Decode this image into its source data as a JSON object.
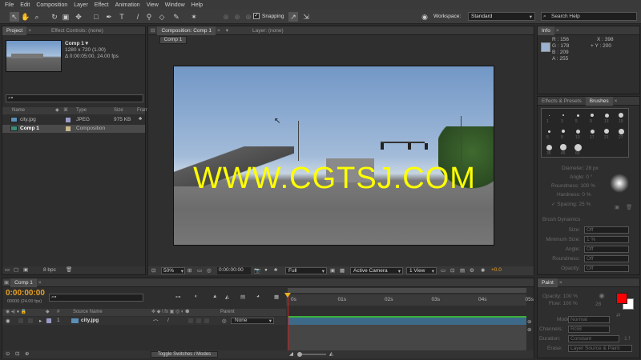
{
  "menu": [
    "File",
    "Edit",
    "Composition",
    "Layer",
    "Effect",
    "Animation",
    "View",
    "Window",
    "Help"
  ],
  "toolbar": {
    "snapping_label": "Snapping",
    "workspace_label": "Workspace:",
    "workspace_value": "Standard",
    "search_placeholder": "Search Help"
  },
  "project": {
    "tab": "Project",
    "effect_controls_tab": "Effect Controls: (none)",
    "selected_name": "Comp 1",
    "selected_dims": "1280 x 720 (1.00)",
    "selected_duration": "Δ 0:00:05:00, 24.00 fps",
    "columns": {
      "name": "Name",
      "type": "Type",
      "size": "Size",
      "frame": "Fram"
    },
    "items": [
      {
        "name": "city.jpg",
        "type": "JPEG",
        "size": "975 KB"
      },
      {
        "name": "Comp 1",
        "type": "Composition",
        "size": ""
      }
    ],
    "bpc": "8 bpc"
  },
  "composition": {
    "tab": "Composition: Comp 1",
    "layer_tab": "Layer: (none)",
    "comp_button": "Comp 1",
    "watermark": "WWW.CGTSJ.COM",
    "zoom": "50%",
    "timecode": "0:00:00:00",
    "resolution": "Full",
    "camera": "Active Camera",
    "view": "1 View",
    "exposure": "+0.0"
  },
  "info": {
    "tab": "Info",
    "r": "R : 156",
    "g": "G : 178",
    "b": "B : 209",
    "a": "A : 255",
    "x": "X : 398",
    "y": "+ Y : 200",
    "swatch": "#9cb2d1"
  },
  "brushes": {
    "tab_effects": "Effects & Presets",
    "tab_brushes": "Brushes",
    "sizes": [
      "1",
      "3",
      "5",
      "9",
      "13",
      "19",
      "5",
      "9",
      "13",
      "17",
      "21",
      "27",
      "35",
      "45",
      "65"
    ],
    "diameter": "Diameter: 28 px",
    "angle": "Angle: 0 °",
    "roundness": "Roundness: 100 %",
    "hardness": "Hardness: 0 %",
    "spacing": "Spacing: 25 %",
    "dynamics": "Brush Dynamics",
    "dyn_rows": [
      {
        "label": "Size:",
        "value": "Off"
      },
      {
        "label": "Minimum Size:",
        "value": "1 %"
      },
      {
        "label": "Angle:",
        "value": "Off"
      },
      {
        "label": "Roundness:",
        "value": "Off"
      },
      {
        "label": "Opacity:",
        "value": "Off"
      }
    ]
  },
  "paint": {
    "tab": "Paint",
    "opacity": "Opacity: 100 %",
    "flow": "Flow: 100 %",
    "brush_num": "28",
    "mode_label": "Mode:",
    "mode_value": "Normal",
    "channels_label": "Channels:",
    "channels_value": "RGB",
    "duration_label": "Duration:",
    "duration_value": "Constant",
    "duration_extra": "1 f",
    "erase_label": "Erase:",
    "erase_value": "Layer Source & Paint",
    "fg_color": "#ff0000",
    "bg_color": "#ffffff"
  },
  "timeline": {
    "tab": "Comp 1",
    "timecode": "0:00:00:00",
    "fps": "00000 (24.00 fps)",
    "ruler": [
      "0s",
      "01s",
      "02s",
      "03s",
      "04s",
      "05s"
    ],
    "col_source": "Source Name",
    "col_parent": "Parent",
    "layer_num": "1",
    "layer_name": "city.jpg",
    "parent_value": "None",
    "toggle_label": "Toggle Switches / Modes"
  }
}
